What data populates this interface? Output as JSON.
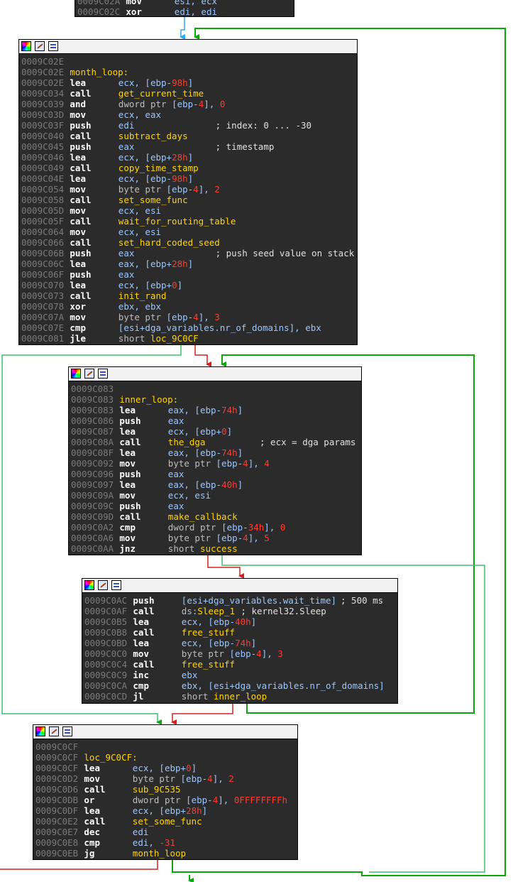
{
  "colors": {
    "true_edge": "#0aa80a",
    "false_edge": "#d62020",
    "jump_edge": "#2fa8ee",
    "loop_edge": "#3ec06a",
    "block_bg": "#2b2b2b"
  },
  "tools": [
    "colors-icon",
    "edit-icon",
    "graph-icon"
  ],
  "blocks": [
    {
      "id": "prev",
      "rows": [
        {
          "a": "0009C02A",
          "m": "mov",
          "o": [
            [
              "esi, ecx",
              "reg"
            ]
          ]
        },
        {
          "a": "0009C02C",
          "m": "xor",
          "o": [
            [
              "edi, edi",
              "reg"
            ]
          ]
        }
      ]
    },
    {
      "id": "month_loop",
      "rows": [
        {
          "a": "0009C02E"
        },
        {
          "a": "0009C02E",
          "l": "month_loop:"
        },
        {
          "a": "0009C02E",
          "m": "lea",
          "o": [
            [
              "ecx, [ebp-",
              "reg"
            ],
            [
              "98h",
              "num"
            ],
            [
              "]",
              "reg"
            ]
          ]
        },
        {
          "a": "0009C034",
          "m": "call",
          "o": [
            [
              "get_current_time",
              "sym"
            ]
          ]
        },
        {
          "a": "0009C039",
          "m": "and",
          "o": [
            [
              "dword ptr ",
              "txt"
            ],
            [
              "[ebp-",
              "reg"
            ],
            [
              "4",
              "num"
            ],
            [
              "], ",
              "reg"
            ],
            [
              "0",
              "num"
            ]
          ]
        },
        {
          "a": "0009C03D",
          "m": "mov",
          "o": [
            [
              "ecx, eax",
              "reg"
            ]
          ]
        },
        {
          "a": "0009C03F",
          "m": "push",
          "o": [
            [
              "edi",
              "reg"
            ]
          ],
          "c": "; index: 0 ... -30"
        },
        {
          "a": "0009C040",
          "m": "call",
          "o": [
            [
              "subtract_days",
              "sym"
            ]
          ]
        },
        {
          "a": "0009C045",
          "m": "push",
          "o": [
            [
              "eax",
              "reg"
            ]
          ],
          "c": "; timestamp"
        },
        {
          "a": "0009C046",
          "m": "lea",
          "o": [
            [
              "ecx, [ebp+",
              "reg"
            ],
            [
              "28h",
              "num"
            ],
            [
              "]",
              "reg"
            ]
          ]
        },
        {
          "a": "0009C049",
          "m": "call",
          "o": [
            [
              "copy_time_stamp",
              "sym"
            ]
          ]
        },
        {
          "a": "0009C04E",
          "m": "lea",
          "o": [
            [
              "ecx, [ebp-",
              "reg"
            ],
            [
              "98h",
              "num"
            ],
            [
              "]",
              "reg"
            ]
          ]
        },
        {
          "a": "0009C054",
          "m": "mov",
          "o": [
            [
              "byte ptr ",
              "txt"
            ],
            [
              "[ebp-",
              "reg"
            ],
            [
              "4",
              "num"
            ],
            [
              "], ",
              "reg"
            ],
            [
              "2",
              "num"
            ]
          ]
        },
        {
          "a": "0009C058",
          "m": "call",
          "o": [
            [
              "set_some_func",
              "sym"
            ]
          ]
        },
        {
          "a": "0009C05D",
          "m": "mov",
          "o": [
            [
              "ecx, esi",
              "reg"
            ]
          ]
        },
        {
          "a": "0009C05F",
          "m": "call",
          "o": [
            [
              "wait_for_routing_table",
              "sym"
            ]
          ]
        },
        {
          "a": "0009C064",
          "m": "mov",
          "o": [
            [
              "ecx, esi",
              "reg"
            ]
          ]
        },
        {
          "a": "0009C066",
          "m": "call",
          "o": [
            [
              "set_hard_coded_seed",
              "sym"
            ]
          ]
        },
        {
          "a": "0009C06B",
          "m": "push",
          "o": [
            [
              "eax",
              "reg"
            ]
          ],
          "c": "; push seed value on stack"
        },
        {
          "a": "0009C06C",
          "m": "lea",
          "o": [
            [
              "eax, [ebp+",
              "reg"
            ],
            [
              "28h",
              "num"
            ],
            [
              "]",
              "reg"
            ]
          ]
        },
        {
          "a": "0009C06F",
          "m": "push",
          "o": [
            [
              "eax",
              "reg"
            ]
          ]
        },
        {
          "a": "0009C070",
          "m": "lea",
          "o": [
            [
              "ecx, [ebp+",
              "reg"
            ],
            [
              "0",
              "num"
            ],
            [
              "]",
              "reg"
            ]
          ]
        },
        {
          "a": "0009C073",
          "m": "call",
          "o": [
            [
              "init_rand",
              "sym"
            ]
          ]
        },
        {
          "a": "0009C078",
          "m": "xor",
          "o": [
            [
              "ebx, ebx",
              "reg"
            ]
          ]
        },
        {
          "a": "0009C07A",
          "m": "mov",
          "o": [
            [
              "byte ptr ",
              "txt"
            ],
            [
              "[ebp-",
              "reg"
            ],
            [
              "4",
              "num"
            ],
            [
              "], ",
              "reg"
            ],
            [
              "3",
              "num"
            ]
          ]
        },
        {
          "a": "0009C07E",
          "m": "cmp",
          "o": [
            [
              "[esi+dga_variables.nr_of_domains], ebx",
              "reg"
            ]
          ]
        },
        {
          "a": "0009C081",
          "m": "jle",
          "o": [
            [
              "short ",
              "txt"
            ],
            [
              "loc_9C0CF",
              "sym"
            ]
          ]
        }
      ]
    },
    {
      "id": "inner_loop",
      "rows": [
        {
          "a": "0009C083"
        },
        {
          "a": "0009C083",
          "l": "inner_loop:"
        },
        {
          "a": "0009C083",
          "m": "lea",
          "o": [
            [
              "eax, [ebp-",
              "reg"
            ],
            [
              "74h",
              "num"
            ],
            [
              "]",
              "reg"
            ]
          ]
        },
        {
          "a": "0009C086",
          "m": "push",
          "o": [
            [
              "eax",
              "reg"
            ]
          ]
        },
        {
          "a": "0009C087",
          "m": "lea",
          "o": [
            [
              "ecx, [ebp+",
              "reg"
            ],
            [
              "0",
              "num"
            ],
            [
              "]",
              "reg"
            ]
          ]
        },
        {
          "a": "0009C08A",
          "m": "call",
          "o": [
            [
              "the_dga",
              "sym"
            ]
          ],
          "c": "; ecx = dga params"
        },
        {
          "a": "0009C08F",
          "m": "lea",
          "o": [
            [
              "eax, [ebp-",
              "reg"
            ],
            [
              "74h",
              "num"
            ],
            [
              "]",
              "reg"
            ]
          ]
        },
        {
          "a": "0009C092",
          "m": "mov",
          "o": [
            [
              "byte ptr ",
              "txt"
            ],
            [
              "[ebp-",
              "reg"
            ],
            [
              "4",
              "num"
            ],
            [
              "], ",
              "reg"
            ],
            [
              "4",
              "num"
            ]
          ]
        },
        {
          "a": "0009C096",
          "m": "push",
          "o": [
            [
              "eax",
              "reg"
            ]
          ]
        },
        {
          "a": "0009C097",
          "m": "lea",
          "o": [
            [
              "eax, [ebp-",
              "reg"
            ],
            [
              "40h",
              "num"
            ],
            [
              "]",
              "reg"
            ]
          ]
        },
        {
          "a": "0009C09A",
          "m": "mov",
          "o": [
            [
              "ecx, esi",
              "reg"
            ]
          ]
        },
        {
          "a": "0009C09C",
          "m": "push",
          "o": [
            [
              "eax",
              "reg"
            ]
          ]
        },
        {
          "a": "0009C09D",
          "m": "call",
          "o": [
            [
              "make_callback",
              "sym"
            ]
          ]
        },
        {
          "a": "0009C0A2",
          "m": "cmp",
          "o": [
            [
              "dword ptr ",
              "txt"
            ],
            [
              "[ebp-",
              "reg"
            ],
            [
              "34h",
              "num"
            ],
            [
              "], ",
              "reg"
            ],
            [
              "0",
              "num"
            ]
          ]
        },
        {
          "a": "0009C0A6",
          "m": "mov",
          "o": [
            [
              "byte ptr ",
              "txt"
            ],
            [
              "[ebp-",
              "reg"
            ],
            [
              "4",
              "num"
            ],
            [
              "], ",
              "reg"
            ],
            [
              "5",
              "num"
            ]
          ]
        },
        {
          "a": "0009C0AA",
          "m": "jnz",
          "o": [
            [
              "short ",
              "txt"
            ],
            [
              "success",
              "sym"
            ]
          ]
        }
      ]
    },
    {
      "id": "sleep_block",
      "rows": [
        {
          "a": "0009C0AC",
          "m": "push",
          "o": [
            [
              "[esi+dga_variables.wait_time]",
              "reg"
            ]
          ],
          "c": "; 500 ms"
        },
        {
          "a": "0009C0AF",
          "m": "call",
          "o": [
            [
              "ds:",
              "txt"
            ],
            [
              "Sleep_1",
              "sym"
            ]
          ],
          "c": "; kernel32.Sleep"
        },
        {
          "a": "0009C0B5",
          "m": "lea",
          "o": [
            [
              "ecx, [ebp-",
              "reg"
            ],
            [
              "40h",
              "num"
            ],
            [
              "]",
              "reg"
            ]
          ]
        },
        {
          "a": "0009C0B8",
          "m": "call",
          "o": [
            [
              "free_stuff",
              "sym"
            ]
          ]
        },
        {
          "a": "0009C0BD",
          "m": "lea",
          "o": [
            [
              "ecx, [ebp-",
              "reg"
            ],
            [
              "74h",
              "num"
            ],
            [
              "]",
              "reg"
            ]
          ]
        },
        {
          "a": "0009C0C0",
          "m": "mov",
          "o": [
            [
              "byte ptr ",
              "txt"
            ],
            [
              "[ebp-",
              "reg"
            ],
            [
              "4",
              "num"
            ],
            [
              "], ",
              "reg"
            ],
            [
              "3",
              "num"
            ]
          ]
        },
        {
          "a": "0009C0C4",
          "m": "call",
          "o": [
            [
              "free_stuff",
              "sym"
            ]
          ]
        },
        {
          "a": "0009C0C9",
          "m": "inc",
          "o": [
            [
              "ebx",
              "reg"
            ]
          ]
        },
        {
          "a": "0009C0CA",
          "m": "cmp",
          "o": [
            [
              "ebx, [esi+dga_variables.nr_of_domains]",
              "reg"
            ]
          ]
        },
        {
          "a": "0009C0CD",
          "m": "jl",
          "o": [
            [
              "short ",
              "txt"
            ],
            [
              "inner_loop",
              "sym"
            ]
          ]
        }
      ]
    },
    {
      "id": "loc_9C0CF",
      "rows": [
        {
          "a": "0009C0CF"
        },
        {
          "a": "0009C0CF",
          "l": "loc_9C0CF:"
        },
        {
          "a": "0009C0CF",
          "m": "lea",
          "o": [
            [
              "ecx, [ebp+",
              "reg"
            ],
            [
              "0",
              "num"
            ],
            [
              "]",
              "reg"
            ]
          ]
        },
        {
          "a": "0009C0D2",
          "m": "mov",
          "o": [
            [
              "byte ptr ",
              "txt"
            ],
            [
              "[ebp-",
              "reg"
            ],
            [
              "4",
              "num"
            ],
            [
              "], ",
              "reg"
            ],
            [
              "2",
              "num"
            ]
          ]
        },
        {
          "a": "0009C0D6",
          "m": "call",
          "o": [
            [
              "sub_9C535",
              "sym"
            ]
          ]
        },
        {
          "a": "0009C0DB",
          "m": "or",
          "o": [
            [
              "dword ptr ",
              "txt"
            ],
            [
              "[ebp-",
              "reg"
            ],
            [
              "4",
              "num"
            ],
            [
              "], ",
              "reg"
            ],
            [
              "0FFFFFFFFh",
              "num"
            ]
          ]
        },
        {
          "a": "0009C0DF",
          "m": "lea",
          "o": [
            [
              "ecx, [ebp+",
              "reg"
            ],
            [
              "28h",
              "num"
            ],
            [
              "]",
              "reg"
            ]
          ]
        },
        {
          "a": "0009C0E2",
          "m": "call",
          "o": [
            [
              "set_some_func",
              "sym"
            ]
          ]
        },
        {
          "a": "0009C0E7",
          "m": "dec",
          "o": [
            [
              "edi",
              "reg"
            ]
          ]
        },
        {
          "a": "0009C0E8",
          "m": "cmp",
          "o": [
            [
              "edi, ",
              "reg"
            ],
            [
              "-31",
              "num"
            ]
          ]
        },
        {
          "a": "0009C0EB",
          "m": "jg",
          "o": [
            [
              "month_loop",
              "sym"
            ]
          ]
        }
      ]
    }
  ]
}
